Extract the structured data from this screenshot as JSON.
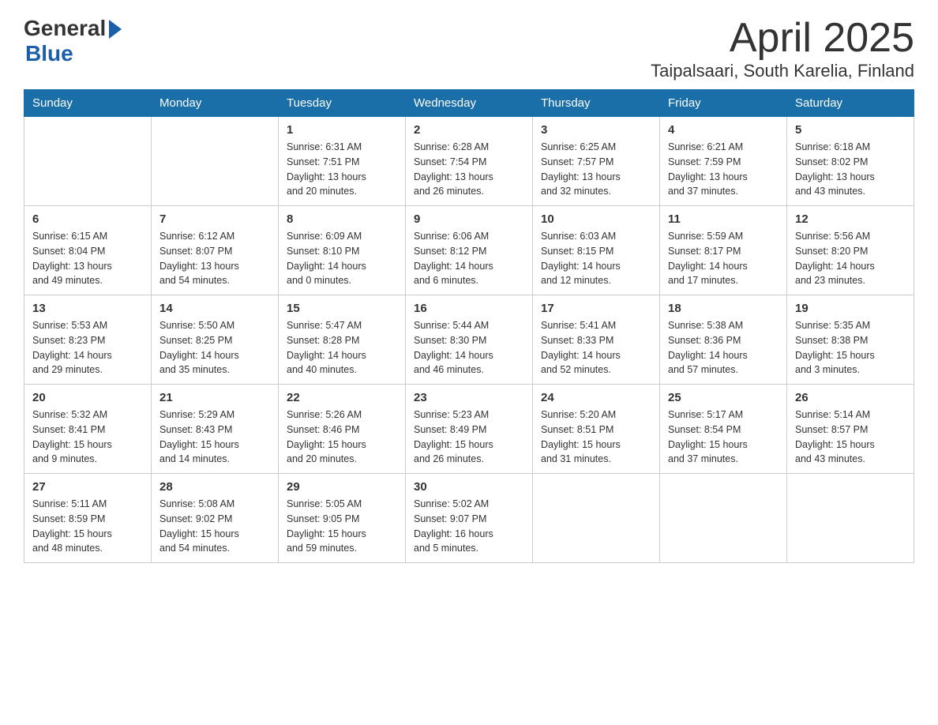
{
  "header": {
    "logo_general": "General",
    "logo_blue": "Blue",
    "month_title": "April 2025",
    "location": "Taipalsaari, South Karelia, Finland"
  },
  "weekdays": [
    "Sunday",
    "Monday",
    "Tuesday",
    "Wednesday",
    "Thursday",
    "Friday",
    "Saturday"
  ],
  "weeks": [
    [
      {
        "day": "",
        "info": ""
      },
      {
        "day": "",
        "info": ""
      },
      {
        "day": "1",
        "info": "Sunrise: 6:31 AM\nSunset: 7:51 PM\nDaylight: 13 hours\nand 20 minutes."
      },
      {
        "day": "2",
        "info": "Sunrise: 6:28 AM\nSunset: 7:54 PM\nDaylight: 13 hours\nand 26 minutes."
      },
      {
        "day": "3",
        "info": "Sunrise: 6:25 AM\nSunset: 7:57 PM\nDaylight: 13 hours\nand 32 minutes."
      },
      {
        "day": "4",
        "info": "Sunrise: 6:21 AM\nSunset: 7:59 PM\nDaylight: 13 hours\nand 37 minutes."
      },
      {
        "day": "5",
        "info": "Sunrise: 6:18 AM\nSunset: 8:02 PM\nDaylight: 13 hours\nand 43 minutes."
      }
    ],
    [
      {
        "day": "6",
        "info": "Sunrise: 6:15 AM\nSunset: 8:04 PM\nDaylight: 13 hours\nand 49 minutes."
      },
      {
        "day": "7",
        "info": "Sunrise: 6:12 AM\nSunset: 8:07 PM\nDaylight: 13 hours\nand 54 minutes."
      },
      {
        "day": "8",
        "info": "Sunrise: 6:09 AM\nSunset: 8:10 PM\nDaylight: 14 hours\nand 0 minutes."
      },
      {
        "day": "9",
        "info": "Sunrise: 6:06 AM\nSunset: 8:12 PM\nDaylight: 14 hours\nand 6 minutes."
      },
      {
        "day": "10",
        "info": "Sunrise: 6:03 AM\nSunset: 8:15 PM\nDaylight: 14 hours\nand 12 minutes."
      },
      {
        "day": "11",
        "info": "Sunrise: 5:59 AM\nSunset: 8:17 PM\nDaylight: 14 hours\nand 17 minutes."
      },
      {
        "day": "12",
        "info": "Sunrise: 5:56 AM\nSunset: 8:20 PM\nDaylight: 14 hours\nand 23 minutes."
      }
    ],
    [
      {
        "day": "13",
        "info": "Sunrise: 5:53 AM\nSunset: 8:23 PM\nDaylight: 14 hours\nand 29 minutes."
      },
      {
        "day": "14",
        "info": "Sunrise: 5:50 AM\nSunset: 8:25 PM\nDaylight: 14 hours\nand 35 minutes."
      },
      {
        "day": "15",
        "info": "Sunrise: 5:47 AM\nSunset: 8:28 PM\nDaylight: 14 hours\nand 40 minutes."
      },
      {
        "day": "16",
        "info": "Sunrise: 5:44 AM\nSunset: 8:30 PM\nDaylight: 14 hours\nand 46 minutes."
      },
      {
        "day": "17",
        "info": "Sunrise: 5:41 AM\nSunset: 8:33 PM\nDaylight: 14 hours\nand 52 minutes."
      },
      {
        "day": "18",
        "info": "Sunrise: 5:38 AM\nSunset: 8:36 PM\nDaylight: 14 hours\nand 57 minutes."
      },
      {
        "day": "19",
        "info": "Sunrise: 5:35 AM\nSunset: 8:38 PM\nDaylight: 15 hours\nand 3 minutes."
      }
    ],
    [
      {
        "day": "20",
        "info": "Sunrise: 5:32 AM\nSunset: 8:41 PM\nDaylight: 15 hours\nand 9 minutes."
      },
      {
        "day": "21",
        "info": "Sunrise: 5:29 AM\nSunset: 8:43 PM\nDaylight: 15 hours\nand 14 minutes."
      },
      {
        "day": "22",
        "info": "Sunrise: 5:26 AM\nSunset: 8:46 PM\nDaylight: 15 hours\nand 20 minutes."
      },
      {
        "day": "23",
        "info": "Sunrise: 5:23 AM\nSunset: 8:49 PM\nDaylight: 15 hours\nand 26 minutes."
      },
      {
        "day": "24",
        "info": "Sunrise: 5:20 AM\nSunset: 8:51 PM\nDaylight: 15 hours\nand 31 minutes."
      },
      {
        "day": "25",
        "info": "Sunrise: 5:17 AM\nSunset: 8:54 PM\nDaylight: 15 hours\nand 37 minutes."
      },
      {
        "day": "26",
        "info": "Sunrise: 5:14 AM\nSunset: 8:57 PM\nDaylight: 15 hours\nand 43 minutes."
      }
    ],
    [
      {
        "day": "27",
        "info": "Sunrise: 5:11 AM\nSunset: 8:59 PM\nDaylight: 15 hours\nand 48 minutes."
      },
      {
        "day": "28",
        "info": "Sunrise: 5:08 AM\nSunset: 9:02 PM\nDaylight: 15 hours\nand 54 minutes."
      },
      {
        "day": "29",
        "info": "Sunrise: 5:05 AM\nSunset: 9:05 PM\nDaylight: 15 hours\nand 59 minutes."
      },
      {
        "day": "30",
        "info": "Sunrise: 5:02 AM\nSunset: 9:07 PM\nDaylight: 16 hours\nand 5 minutes."
      },
      {
        "day": "",
        "info": ""
      },
      {
        "day": "",
        "info": ""
      },
      {
        "day": "",
        "info": ""
      }
    ]
  ]
}
